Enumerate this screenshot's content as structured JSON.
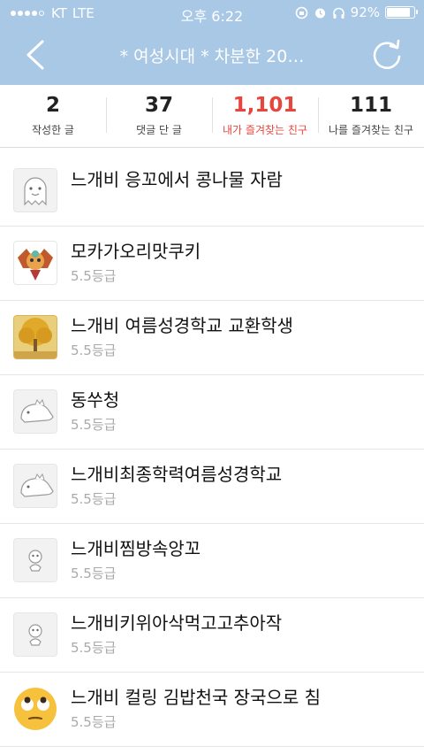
{
  "status_bar": {
    "carrier": "KT",
    "network": "LTE",
    "time": "오후 6:22",
    "battery": "92%"
  },
  "nav": {
    "title": "* 여성시대 *  차분한 20…",
    "back_icon": "chevron-left-icon",
    "refresh_icon": "refresh-icon"
  },
  "stats": [
    {
      "value": "2",
      "label": "작성한 글"
    },
    {
      "value": "37",
      "label": "댓글 단 글"
    },
    {
      "value": "1,101",
      "label": "내가 즐겨찾는 친구"
    },
    {
      "value": "111",
      "label": "나를 즐겨찾는 친구"
    }
  ],
  "active_color": "#e8453c",
  "header_color": "#a9c8e6",
  "friends": [
    {
      "name": "느개비 응꼬에서 콩나물 자람",
      "grade": "",
      "avatar": "ghost-avatar"
    },
    {
      "name": "모카가오리맛쿠키",
      "grade": "5.5등급",
      "avatar": "cookie-character-avatar"
    },
    {
      "name": "느개비 여름성경학교 교환학생",
      "grade": "5.5등급",
      "avatar": "golden-tree-avatar"
    },
    {
      "name": "동쑤청",
      "grade": "5.5등급",
      "avatar": "dino-avatar"
    },
    {
      "name": "느개비최종학력여름성경학교",
      "grade": "5.5등급",
      "avatar": "dino-avatar"
    },
    {
      "name": "느개비찜방속앙꼬",
      "grade": "5.5등급",
      "avatar": "small-figure-avatar"
    },
    {
      "name": "느개비키위아삭먹고고추아작",
      "grade": "5.5등급",
      "avatar": "small-figure-avatar"
    },
    {
      "name": "느개비 컬링 김밥천국 장국으로 침",
      "grade": "5.5등급",
      "avatar": "eye-roll-emoji-avatar"
    }
  ]
}
